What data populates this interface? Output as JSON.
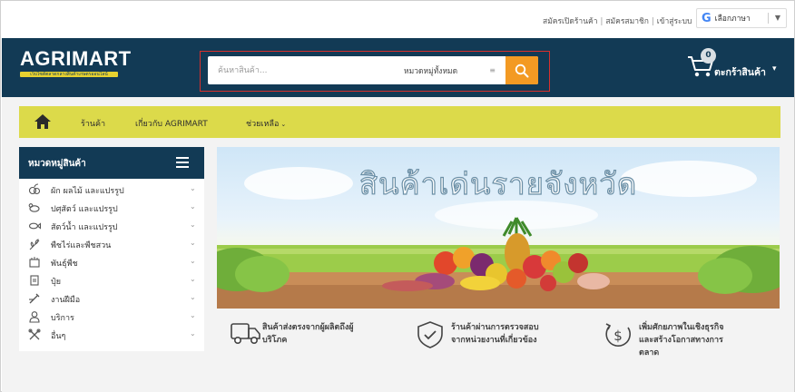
{
  "top_links": {
    "register_shop": "สมัครเปิดร้านค้า",
    "register_member": "สมัครสมาชิก",
    "login": "เข้าสู่ระบบ",
    "separator": "|"
  },
  "language": {
    "label": "เลือกภาษา",
    "google_letter": "G"
  },
  "header": {
    "logo_text": "AGRIMART",
    "logo_tagline": "เว็บไซต์ตลาดกลางสินค้าเกษตรออนไลน์",
    "search_placeholder": "ค้นหาสินค้า...",
    "search_category": "หมวดหมู่ทั้งหมด",
    "cart_count": "0",
    "cart_label": "ตะกร้าสินค้า"
  },
  "menubar": {
    "items": [
      {
        "label": "ร้านค้า"
      },
      {
        "label": "เกี่ยวกับ AGRIMART"
      },
      {
        "label": "ช่วยเหลือ"
      }
    ]
  },
  "sidebar": {
    "title": "หมวดหมู่สินค้า",
    "categories": [
      {
        "label": "ผัก ผลไม้ และแปรรูป",
        "icon": "fruit-icon"
      },
      {
        "label": "ปศุสัตว์ และแปรรูป",
        "icon": "livestock-icon"
      },
      {
        "label": "สัตว์น้ำ และแปรรูป",
        "icon": "fish-icon"
      },
      {
        "label": "พืชไร่และพืชสวน",
        "icon": "plant-icon"
      },
      {
        "label": "พันธุ์พืช",
        "icon": "seed-icon"
      },
      {
        "label": "ปุ๋ย",
        "icon": "fertilizer-icon"
      },
      {
        "label": "งานฝีมือ",
        "icon": "craft-icon"
      },
      {
        "label": "บริการ",
        "icon": "service-icon"
      },
      {
        "label": "อื่นๆ",
        "icon": "tools-icon"
      }
    ]
  },
  "banner": {
    "title": "สินค้าเด่นรายจังหวัด"
  },
  "features": [
    {
      "line1": "สินค้าส่งตรงจากผู้ผลิตถึงผู้",
      "line2": "บริโภค",
      "line3": "",
      "icon": "truck-icon"
    },
    {
      "line1": "ร้านค้าผ่านการตรวจสอบ",
      "line2": "จากหน่วยงานที่เกี่ยวข้อง",
      "line3": "",
      "icon": "shield-check-icon"
    },
    {
      "line1": "เพิ่มศักยภาพในเชิงธุรกิจ",
      "line2": "และสร้างโอกาสทางการ",
      "line3": "ตลาด",
      "icon": "dollar-growth-icon"
    }
  ],
  "colors": {
    "header_bg": "#123a55",
    "menubar_bg": "#dcda4a",
    "search_button": "#f39a23",
    "highlight_outline": "#d9302c"
  }
}
